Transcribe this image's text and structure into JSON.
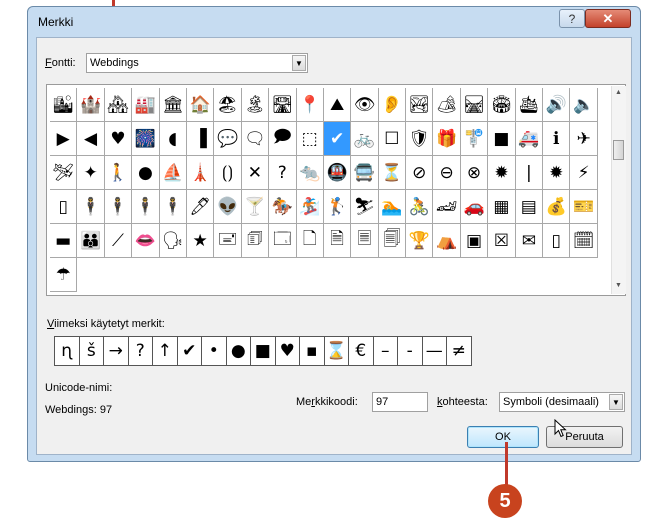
{
  "window": {
    "title": "Merkki",
    "help_label": "?",
    "close_label": "✕"
  },
  "font_field": {
    "label_underlined": "F",
    "label_rest": "ontti:",
    "value": "Webdings"
  },
  "symbol_grid": {
    "rows": [
      [
        "🏙",
        "🏰",
        "🏘",
        "🏭",
        "🏛",
        "🏠",
        "🏖",
        "🏝",
        "🛣",
        "📍",
        "⛰",
        "👁",
        "👂",
        "🏞",
        "🏕",
        "🛤"
      ],
      [
        "🏟",
        "🛳",
        "🔊",
        "🔈",
        "▶",
        "◀",
        "♥",
        "🎆",
        "◖",
        "▐",
        "💬",
        "🗨",
        "🗩",
        "⬚",
        "✔",
        "🚲",
        "☐"
      ],
      [
        "🛡",
        "🎁",
        "🚏",
        "■",
        "🚑",
        "ℹ",
        "✈",
        "🛩",
        "✦",
        "🚶",
        "●",
        "⛵",
        "🗼",
        "⟮⟯",
        "✕",
        "?",
        "🐀"
      ],
      [
        "🚇",
        "🚍",
        "⏳",
        "⊘",
        "⊖",
        "⊗",
        "✹",
        "|",
        "✹",
        "⚡",
        "▯",
        "🕴",
        "🕴",
        "🕴",
        "🕴",
        "🖊",
        "👽"
      ],
      [
        "🍸",
        "🏇",
        "🏂",
        "🏌",
        "⛷",
        "🏊",
        "🚴",
        "🏎",
        "🚗",
        "▦",
        "▤",
        "💰",
        "🎫",
        "▬",
        "👪",
        "⟋",
        "👄"
      ],
      [
        "🗣",
        "★",
        "🖃",
        "🗊",
        "🗔",
        "🗋",
        "🗎",
        "🗏",
        "🗐",
        "🏆",
        "⛺",
        "▣",
        "☒",
        "✉",
        "▯",
        "🗓",
        "☂"
      ]
    ],
    "selected_symbol": "✔"
  },
  "recent": {
    "label_underlined": "V",
    "label_rest": "iimeksi käytetyt merkit:",
    "symbols": [
      "ɳ",
      "š",
      "→",
      "?",
      "↑",
      "✔",
      "•",
      "●",
      "■",
      "♥",
      "▪",
      "⌛",
      "€",
      "–",
      "-",
      "—",
      "≠"
    ]
  },
  "unicode_name": {
    "label": "Unicode-nimi:",
    "value": "Webdings: 97"
  },
  "char_code": {
    "label_pre": "Me",
    "label_underlined": "r",
    "label_post": "kkikoodi:",
    "value": "97"
  },
  "from_field": {
    "label_underlined": "k",
    "label_rest": "ohteesta:",
    "value": "Symboli (desimaali)"
  },
  "buttons": {
    "ok": "OK",
    "cancel": "Peruuta"
  },
  "callout": {
    "number": "5",
    "color": "#c8431e"
  },
  "colors": {
    "selection": "#3399ff",
    "title_bg": "#c6dcf1",
    "close_bg": "#c3422b"
  }
}
